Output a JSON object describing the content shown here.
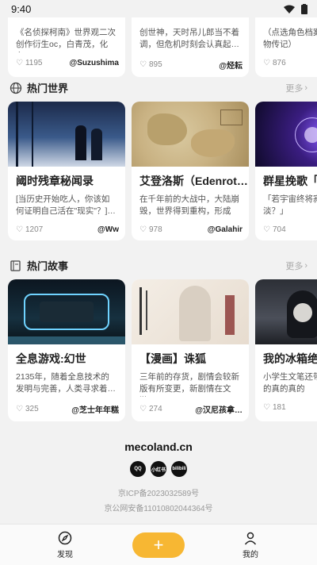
{
  "status": {
    "time": "9:40"
  },
  "top_cards": [
    {
      "desc": "《名侦探柯南》世界观二次创作衍生oc，白青茂，化名…",
      "likes": "1195",
      "author": "@Suzushima"
    },
    {
      "desc": "创世神，天时吊儿郎当不着调，但危机时刻会认真起…",
      "likes": "895",
      "author": "@烃耘"
    },
    {
      "desc": "（点选角色档案可曲还有人物传记）",
      "likes": "876",
      "author": ""
    }
  ],
  "worlds": {
    "title": "热门世界",
    "more": "更多",
    "cards": [
      {
        "title": "阈时残章秘闻录",
        "desc": "[当历史开始吃人，你该如何证明自己活在\"现实\"？]…",
        "likes": "1207",
        "author": "@Ww"
      },
      {
        "title": "艾登洛斯（Edenrot…",
        "desc": "在千年前的大战中，大陆崩毁，世界得到重构，形成了…",
        "likes": "978",
        "author": "@Galahir"
      },
      {
        "title": "群星挽歌「整合",
        "desc": "「若宇宙终将寂灭星光黯淡？」",
        "likes": "704",
        "author": "@"
      }
    ]
  },
  "stories": {
    "title": "热门故事",
    "more": "更多",
    "cards": [
      {
        "title": "全息游戏:幻世",
        "desc": "2135年，随着全息技术的发明与完善，人类寻求着…",
        "likes": "325",
        "author": "@芝士年年糕"
      },
      {
        "title": "【漫画】诛狐",
        "desc": "三年前的存货，剧情会较新版有所变更，新剧情在文游…",
        "likes": "274",
        "author": "@汉尼孩拿…"
      },
      {
        "title": "我的冰箱绝对不",
        "desc": "小学生文笔还带了有病，真的真的真的",
        "likes": "181",
        "author": ""
      }
    ]
  },
  "footer": {
    "brand": "mecoland.cn",
    "socials": [
      "QQ",
      "小红书",
      "bilibili"
    ],
    "icp": "京ICP备2023032589号",
    "police": "京公网安备11010802044364号"
  },
  "nav": {
    "discover": "发现",
    "add": "+",
    "mine": "我的"
  },
  "colors": {
    "accent": "#f7b733",
    "background": "#f2f2f2"
  }
}
